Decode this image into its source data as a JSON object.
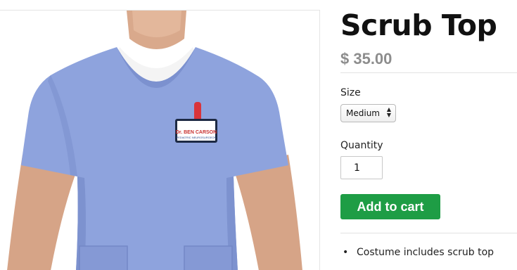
{
  "product": {
    "image_alt": "Man wearing a light blue scrub top with a name badge",
    "badge_line1": "Dr. BEN CARSON",
    "badge_line2": "PEDIATRIC NEUROSURGEON",
    "title": "Scrub Top",
    "price": "$ 35.00"
  },
  "form": {
    "size_label": "Size",
    "size_selected": "Medium",
    "quantity_label": "Quantity",
    "quantity_value": "1",
    "add_to_cart_label": "Add to cart"
  },
  "features": [
    "Costume includes scrub top"
  ],
  "colors": {
    "button": "#1e9d45",
    "price": "#8d8d8d",
    "scrub": "#8ea3dd"
  },
  "icons": {
    "select_arrows": "up-down-arrows-icon",
    "bullet": "bullet-icon"
  }
}
